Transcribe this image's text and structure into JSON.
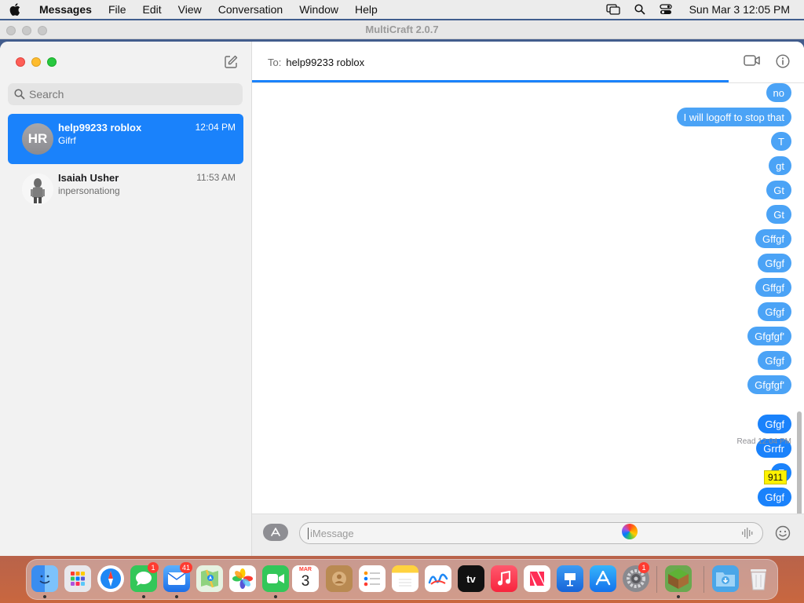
{
  "menubar": {
    "items": [
      "Messages",
      "File",
      "Edit",
      "View",
      "Conversation",
      "Window",
      "Help"
    ],
    "clock": "Sun Mar 3  12:05 PM"
  },
  "background_window": {
    "title": "MultiCraft 2.0.7"
  },
  "sidebar": {
    "search_placeholder": "Search",
    "conversations": [
      {
        "initials": "HR",
        "name": "help99233 roblox",
        "time": "12:04 PM",
        "preview": "Gifrf"
      },
      {
        "initials": "",
        "name": "Isaiah Usher",
        "time": "11:53 AM",
        "preview": "inpersonationg"
      }
    ]
  },
  "header": {
    "to_label": "To:",
    "recipient": "help99233 roblox"
  },
  "thread": {
    "messages": [
      {
        "text": "no",
        "style": "light"
      },
      {
        "text": "I will logoff to stop that",
        "style": "light"
      },
      {
        "text": "T",
        "style": "light"
      },
      {
        "text": "gt",
        "style": "light"
      },
      {
        "text": "Gt",
        "style": "light"
      },
      {
        "text": "Gt",
        "style": "light"
      },
      {
        "text": "Gffgf",
        "style": "light"
      },
      {
        "text": "Gfgf",
        "style": "light"
      },
      {
        "text": "Gffgf",
        "style": "light"
      },
      {
        "text": "Gfgf",
        "style": "light"
      },
      {
        "text": "Gfgfgf'",
        "style": "light"
      },
      {
        "text": "Gfgf",
        "style": "light"
      },
      {
        "text": "Gfgfgf'",
        "style": "light"
      },
      {
        "text": "Gfgf",
        "style": "dark"
      },
      {
        "text": "Grrfr",
        "style": "dark"
      },
      {
        "text": "F",
        "style": "dark"
      },
      {
        "text": "Gfgf",
        "style": "dark"
      }
    ],
    "read_receipt_label": "Read",
    "read_receipt_time": "12:04 PM",
    "overlay_badge": "911"
  },
  "composer": {
    "placeholder": "iMessage"
  },
  "dock": {
    "calendar_month": "MAR",
    "calendar_day": "3",
    "tv_label": "tv",
    "messages_badge": "1",
    "mail_badge": "41",
    "settings_badge": "1"
  },
  "colors": {
    "accent": "#1a82fb",
    "bubble_light": "#4ba3f6",
    "sidebar_bg": "#f2f2f2"
  }
}
